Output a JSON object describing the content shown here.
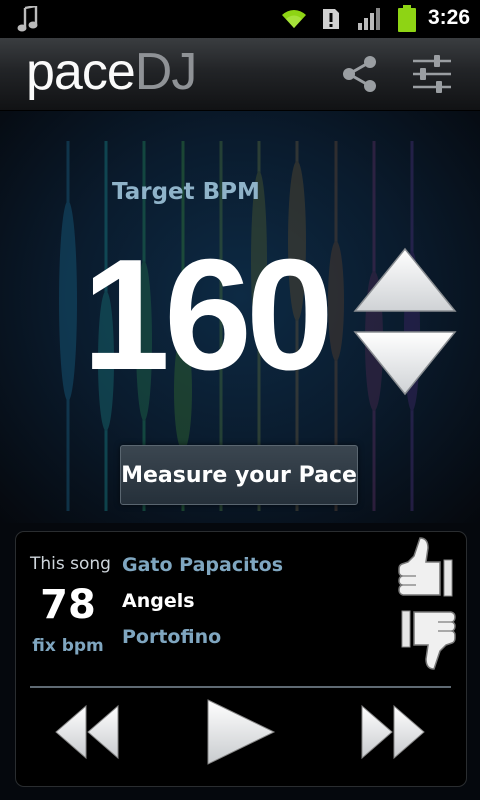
{
  "status_bar": {
    "time": "3:26",
    "icons": [
      "music-note-icon",
      "wifi-icon",
      "alert-icon",
      "signal-icon",
      "battery-icon"
    ]
  },
  "app_bar": {
    "logo_part1": "pace",
    "logo_part2": "DJ",
    "icons": [
      "share-icon",
      "settings-icon"
    ]
  },
  "main": {
    "target_label": "Target BPM",
    "bpm_value": "160",
    "measure_button": "Measure your Pace"
  },
  "player": {
    "this_song_label": "This song",
    "song_bpm": "78",
    "fix_bpm_label": "fix bpm",
    "artist": "Gato Papacitos",
    "title": "Angels",
    "album": "Portofino",
    "icons": [
      "thumbs-up-icon",
      "thumbs-down-icon",
      "rewind-icon",
      "play-icon",
      "fast-forward-icon"
    ]
  },
  "colors": {
    "accent_blue": "#7fa6c0",
    "battery_green": "#8ed414",
    "background": "#05080d"
  }
}
